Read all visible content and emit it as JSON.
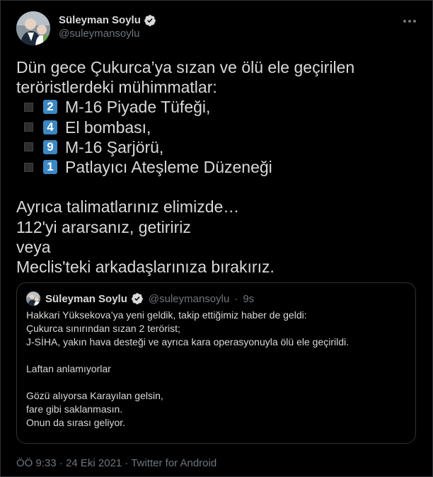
{
  "author": {
    "display_name": "Süleyman Soylu",
    "handle": "@suleymansoylu",
    "avatar_icon": "profile-photo-icon",
    "verified_icon": "verified-badge-icon"
  },
  "colors": {
    "background": "#000000",
    "text": "#d9d9d9",
    "secondary": "#6e767d",
    "border": "#2f3336",
    "verified": "#d9d9d9",
    "keycap": "#3b88c3"
  },
  "tweet": {
    "intro": [
      "Dün gece Çukurca’ya sızan ve ölü ele geçirilen",
      "teröristlerdeki mühimmatlar:"
    ],
    "items": [
      {
        "count": "2",
        "label": "M-16 Piyade Tüfeği,"
      },
      {
        "count": "4",
        "label": "El bombası,"
      },
      {
        "count": "9",
        "label": "M-16 Şarjörü,"
      },
      {
        "count": "1",
        "label": "Patlayıcı Ateşleme Düzeneği"
      }
    ],
    "closing": [
      "Ayrıca talimatlarınız elimizde…",
      "112'yi ararsanız, getiririz",
      "veya",
      "Meclis'teki arkadaşlarınıza bırakırız."
    ]
  },
  "quoted_tweet": {
    "display_name": "Süleyman Soylu",
    "handle": "@suleymansoylu",
    "time": "9s",
    "separator": "·",
    "paragraph1": [
      "Hakkari Yüksekova’ya yeni geldik, takip ettiğimiz haber de geldi:",
      "Çukurca sınırından sızan 2 terörist;",
      "J-SİHA, yakın hava desteği ve ayrıca kara operasyonuyla ölü ele geçirildi."
    ],
    "paragraph2": "Laftan anlamıyorlar",
    "paragraph3": [
      "Gözü alıyorsa Karayılan gelsin,",
      "fare gibi saklanmasın.",
      "Onun da sırası geliyor."
    ]
  },
  "footer": {
    "text": "ÖÖ 9:33 · 24 Eki 2021 · Twitter for Android"
  }
}
